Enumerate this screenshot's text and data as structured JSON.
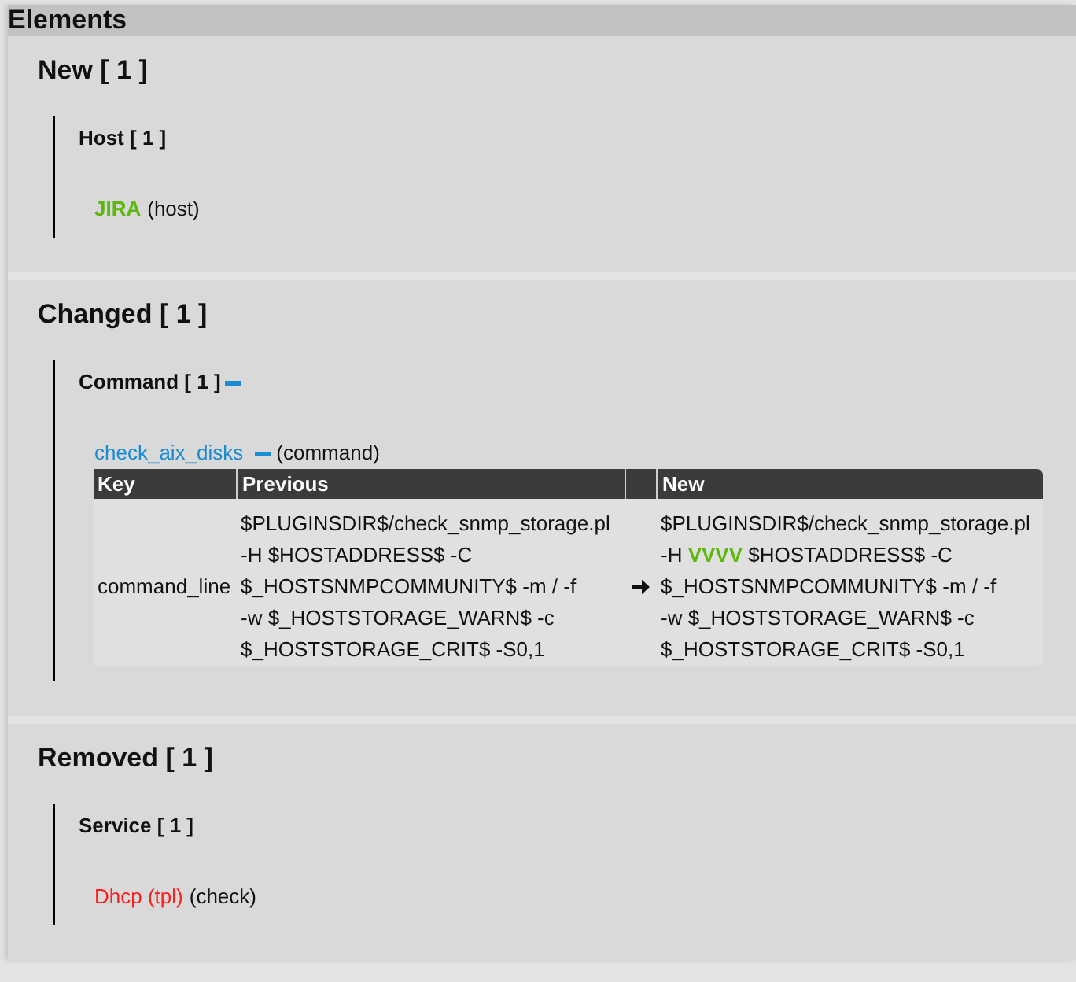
{
  "header": {
    "title": "Elements"
  },
  "sections": [
    {
      "title": "New [ 1 ]",
      "groups": [
        {
          "title": "Host [ 1 ]",
          "items": [
            {
              "kind": "added",
              "name": "JIRA",
              "type": "(host)"
            }
          ]
        }
      ]
    },
    {
      "title": "Changed [ 1 ]",
      "groups": [
        {
          "title": "Command [ 1 ]",
          "expanded": true,
          "items": [
            {
              "kind": "changed",
              "name": "check_aix_disks",
              "expanded": true,
              "type": "(command)",
              "diff": {
                "columns": [
                  "Key",
                  "Previous",
                  "New"
                ],
                "rows": [
                  {
                    "key": "command_line",
                    "previous": [
                      [
                        {
                          "kind": "same",
                          "text": "$PLUGINSDIR$/check_snmp_storage.pl"
                        }
                      ],
                      [
                        {
                          "kind": "same",
                          "text": "-H $HOSTADDRESS$ -C"
                        }
                      ],
                      [
                        {
                          "kind": "same",
                          "text": "$_HOSTSNMPCOMMUNITY$ -m / -f"
                        }
                      ],
                      [
                        {
                          "kind": "same",
                          "text": "-w $_HOSTSTORAGE_WARN$ -c"
                        }
                      ],
                      [
                        {
                          "kind": "same",
                          "text": "$_HOSTSTORAGE_CRIT$ -S0,1"
                        }
                      ]
                    ],
                    "new": [
                      [
                        {
                          "kind": "same",
                          "text": "$PLUGINSDIR$/check_snmp_storage.pl"
                        }
                      ],
                      [
                        {
                          "kind": "same",
                          "text": "-H "
                        },
                        {
                          "kind": "added",
                          "text": "VVVV"
                        },
                        {
                          "kind": "same",
                          "text": " $HOSTADDRESS$ -C"
                        }
                      ],
                      [
                        {
                          "kind": "same",
                          "text": "$_HOSTSNMPCOMMUNITY$ -m / -f"
                        }
                      ],
                      [
                        {
                          "kind": "same",
                          "text": "-w $_HOSTSTORAGE_WARN$ -c"
                        }
                      ],
                      [
                        {
                          "kind": "same",
                          "text": "$_HOSTSTORAGE_CRIT$ -S0,1"
                        }
                      ]
                    ]
                  }
                ]
              }
            }
          ]
        }
      ]
    },
    {
      "title": "Removed [ 1 ]",
      "groups": [
        {
          "title": "Service [ 1 ]",
          "items": [
            {
              "kind": "removed",
              "name": "Dhcp (tpl)",
              "type": "(check)"
            }
          ]
        }
      ]
    }
  ]
}
